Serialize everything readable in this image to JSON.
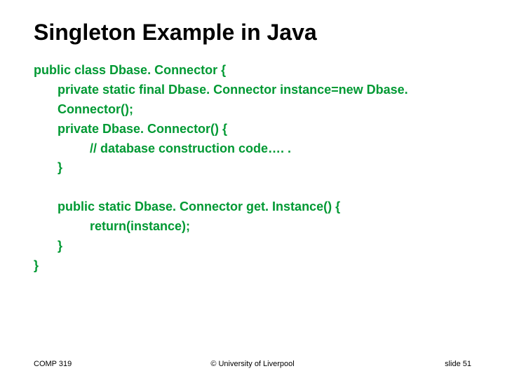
{
  "title": "Singleton Example in Java",
  "code": {
    "l1": "public class Dbase. Connector {",
    "l2": "private static final Dbase. Connector instance=new Dbase. Connector();",
    "l3": "private Dbase. Connector() {",
    "l4": "// database construction code…. .",
    "l5": "}",
    "l6": "public static Dbase. Connector get. Instance() {",
    "l7": "return(instance);",
    "l8": "}",
    "l9": "}"
  },
  "footer": {
    "left": "COMP 319",
    "center": "© University of Liverpool",
    "right": "slide  51"
  }
}
